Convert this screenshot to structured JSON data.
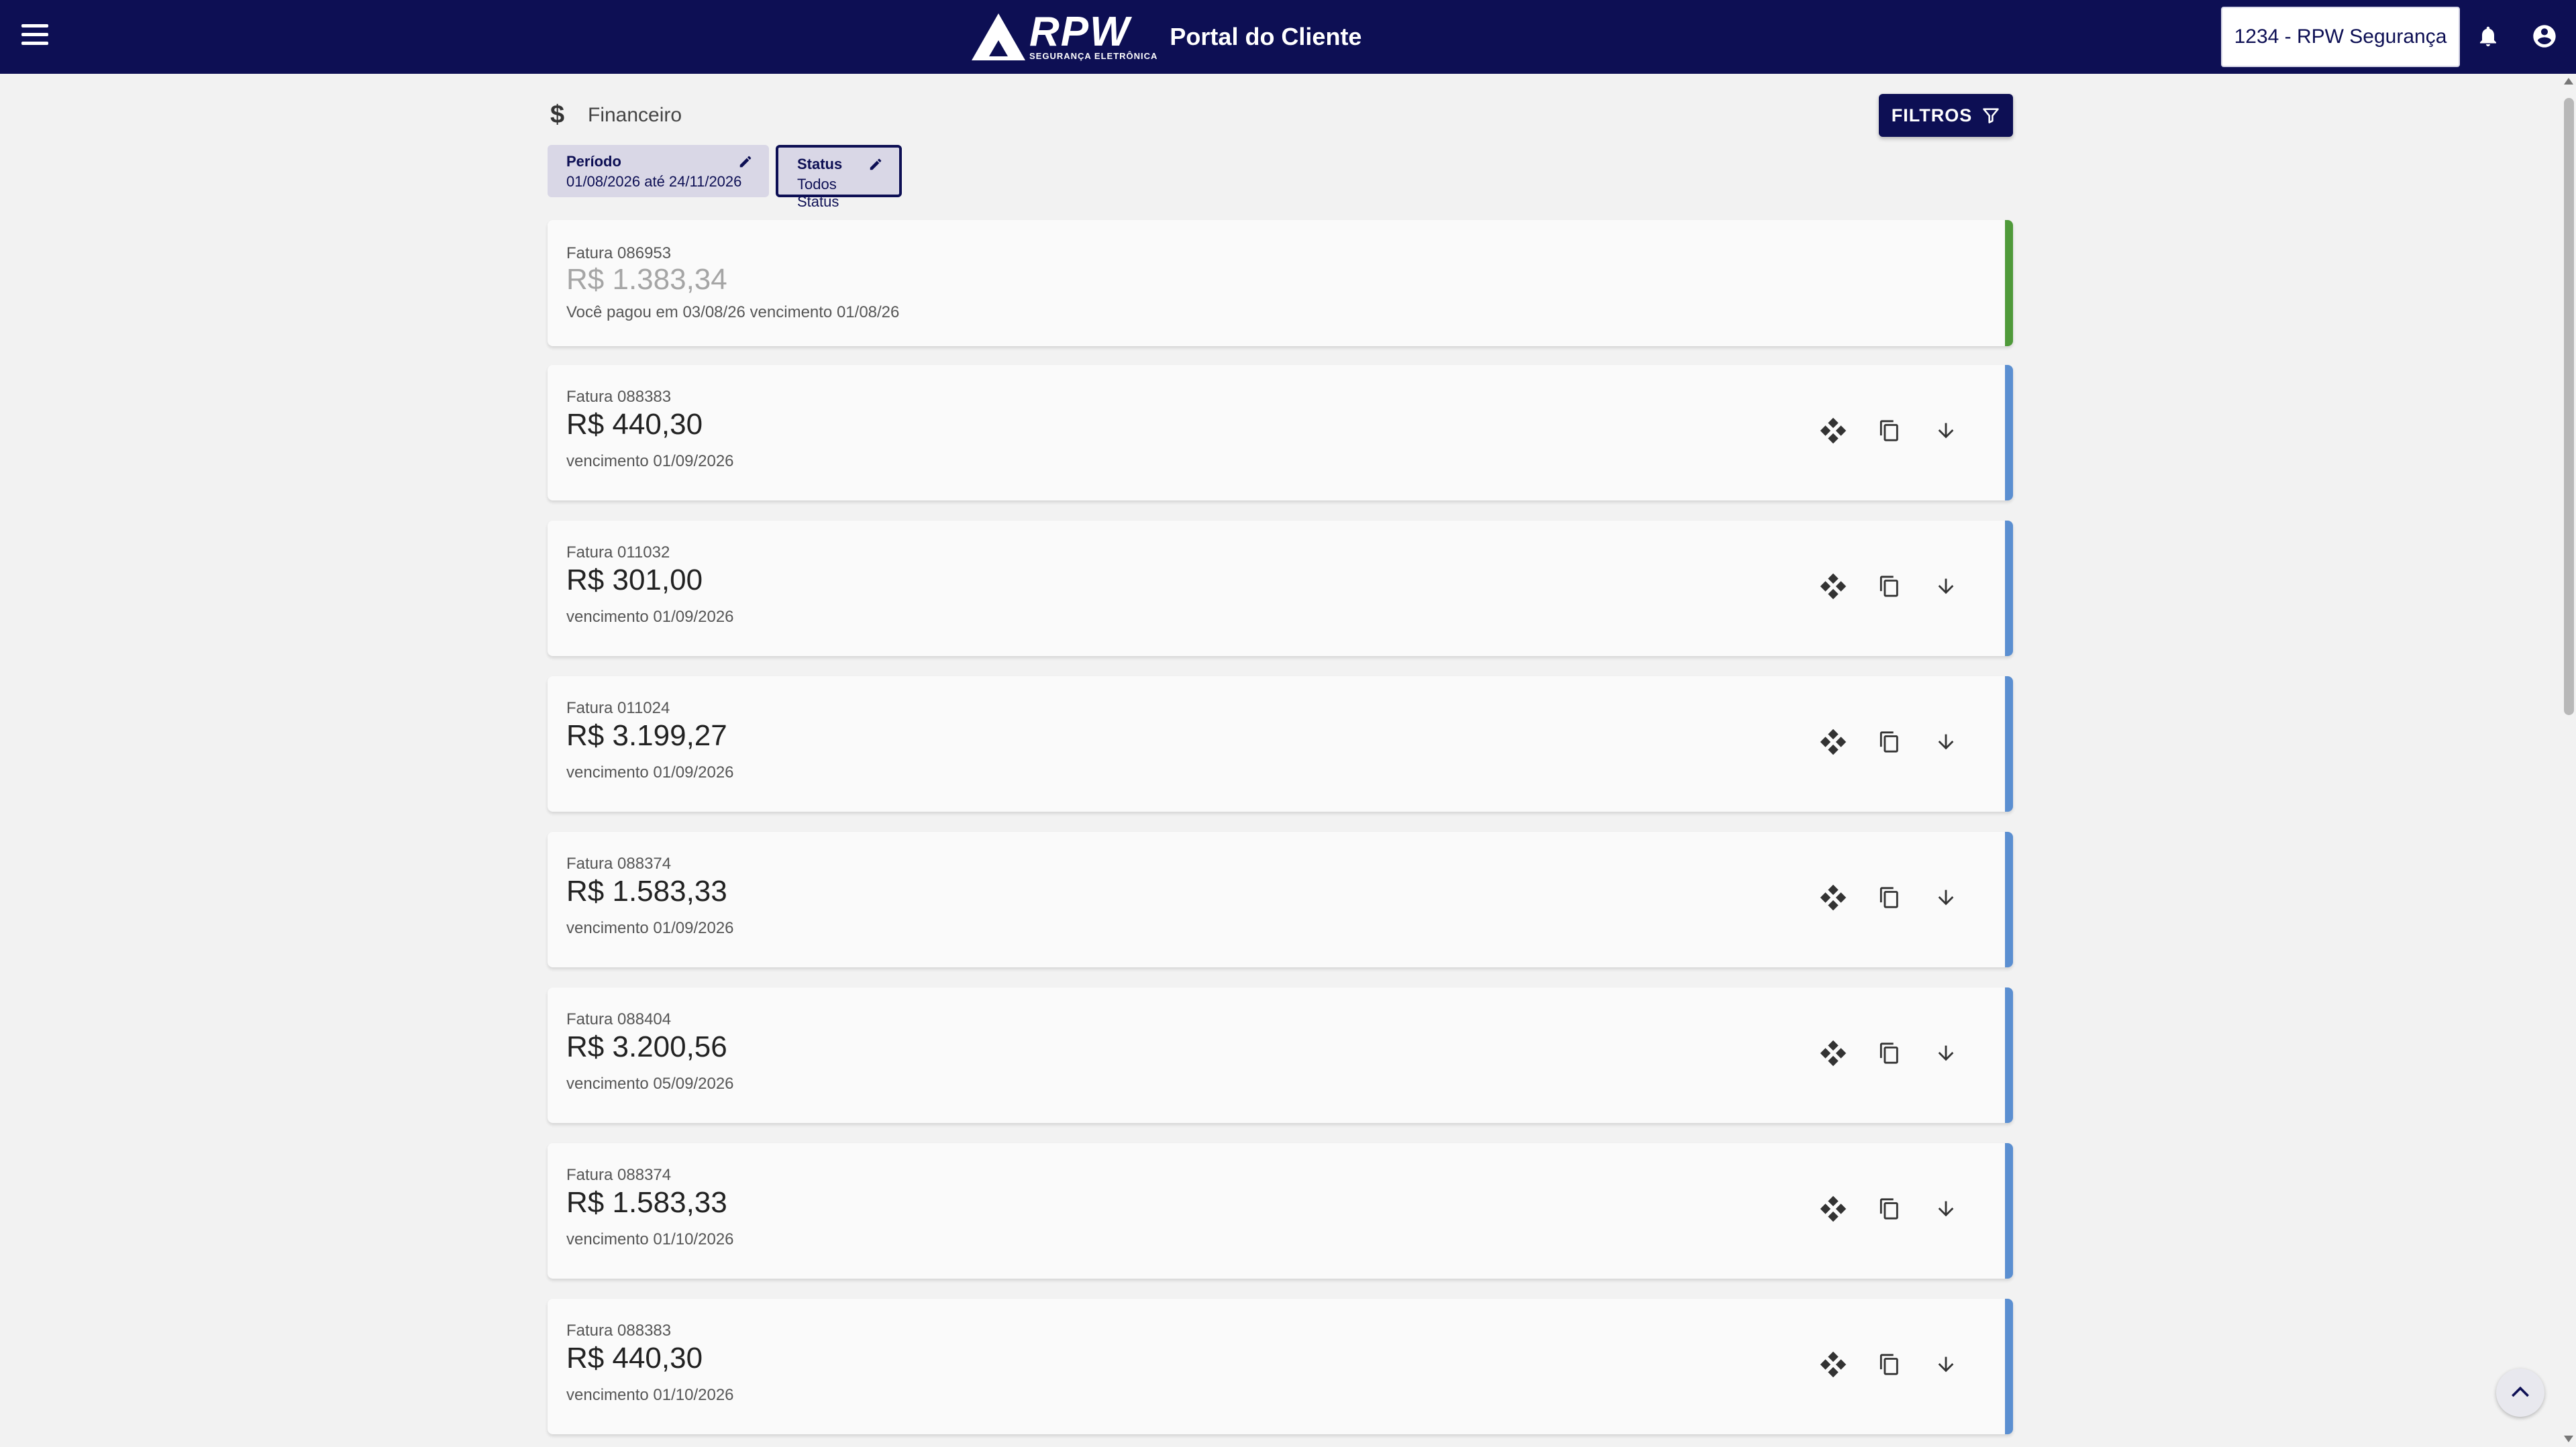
{
  "header": {
    "logo_text": "RPW",
    "logo_sub": "SEGURANÇA ELETRÔNICA",
    "title": "Portal do Cliente",
    "account": "1234 - RPW Segurança",
    "icons": [
      "menu-icon",
      "bell-icon",
      "account-circle-icon"
    ]
  },
  "page": {
    "section_title": "Financeiro",
    "filter_label": "FILTROS"
  },
  "chips": {
    "period": {
      "label": "Período",
      "value": "01/08/2026 até 24/11/2026"
    },
    "status": {
      "label": "Status",
      "value": "Todos Status"
    }
  },
  "colors": {
    "navy": "#0d0f54",
    "paid_accent": "#4f9a3a",
    "pending_accent": "#5b8fd1"
  },
  "invoices": [
    {
      "label": "Fatura 086953",
      "amount": "R$ 1.383,34",
      "due": "Você pagou em 03/08/26  vencimento 01/08/26",
      "status": "paid"
    },
    {
      "label": "Fatura  088383",
      "amount": "R$ 440,30",
      "due": "vencimento 01/09/2026",
      "status": "pending"
    },
    {
      "label": "Fatura  011032",
      "amount": "R$ 301,00",
      "due": "vencimento 01/09/2026",
      "status": "pending"
    },
    {
      "label": "Fatura  011024",
      "amount": "R$ 3.199,27",
      "due": "vencimento 01/09/2026",
      "status": "pending"
    },
    {
      "label": "Fatura  088374",
      "amount": "R$ 1.583,33",
      "due": "vencimento 01/09/2026",
      "status": "pending"
    },
    {
      "label": "Fatura  088404",
      "amount": "R$ 3.200,56",
      "due": "vencimento 05/09/2026",
      "status": "pending"
    },
    {
      "label": "Fatura  088374",
      "amount": "R$ 1.583,33",
      "due": "vencimento 01/10/2026",
      "status": "pending"
    },
    {
      "label": "Fatura  088383",
      "amount": "R$ 440,30",
      "due": "vencimento 01/10/2026",
      "status": "pending"
    }
  ]
}
